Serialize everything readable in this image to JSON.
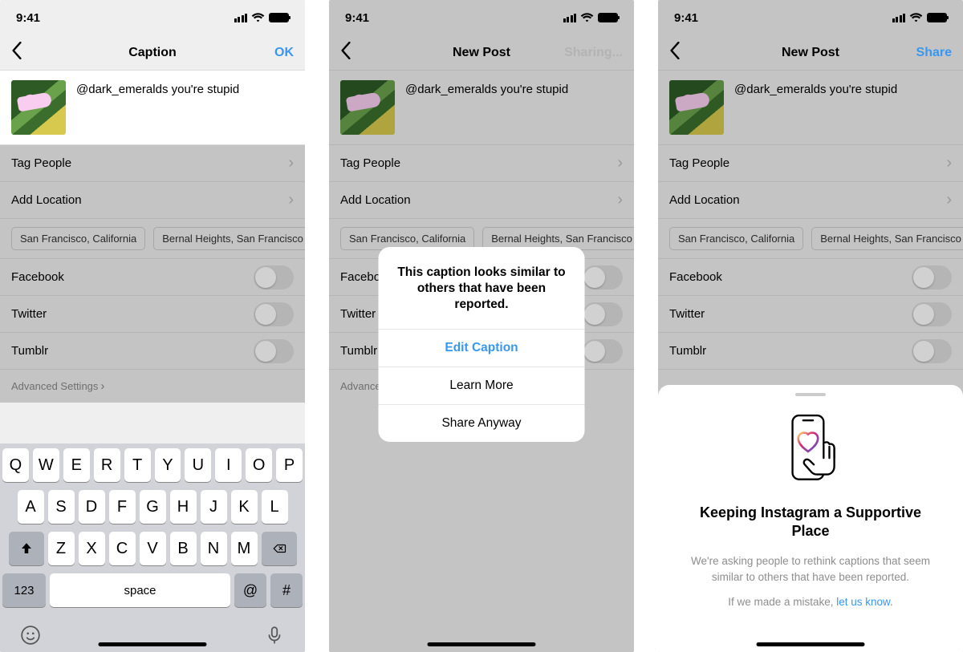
{
  "status_time": "9:41",
  "screens": {
    "s1": {
      "title": "Caption",
      "action": "OK"
    },
    "s2": {
      "title": "New Post",
      "action": "Sharing..."
    },
    "s3": {
      "title": "New Post",
      "action": "Share"
    }
  },
  "caption": "@dark_emeralds you're stupid",
  "rows": {
    "tag": "Tag People",
    "loc": "Add Location"
  },
  "loc_chips": [
    "San Francisco, California",
    "Bernal Heights, San Francisco"
  ],
  "share": {
    "fb": "Facebook",
    "tw": "Twitter",
    "tb": "Tumblr"
  },
  "advanced": "Advanced Settings",
  "keyboard": {
    "r1": [
      "Q",
      "W",
      "E",
      "R",
      "T",
      "Y",
      "U",
      "I",
      "O",
      "P"
    ],
    "r2": [
      "A",
      "S",
      "D",
      "F",
      "G",
      "H",
      "J",
      "K",
      "L"
    ],
    "r3": [
      "Z",
      "X",
      "C",
      "V",
      "B",
      "N",
      "M"
    ],
    "num": "123",
    "space": "space",
    "at": "@",
    "hash": "#"
  },
  "modal": {
    "message": "This caption looks similar to others that have been reported.",
    "edit": "Edit Caption",
    "learn": "Learn More",
    "share": "Share Anyway"
  },
  "sheet": {
    "title": "Keeping Instagram a Supportive Place",
    "body": "We're asking people to rethink captions that seem similar to others that have been reported.",
    "mistake_pre": "If we made a mistake, ",
    "mistake_link": "let us know",
    "mistake_post": "."
  }
}
